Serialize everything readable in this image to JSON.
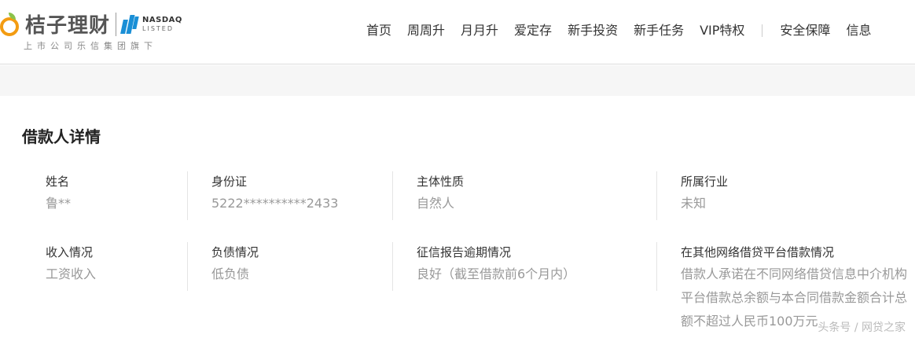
{
  "header": {
    "brand_name": "桔子理财",
    "nasdaq_line1": "NASDAQ",
    "nasdaq_line2": "LISTED",
    "tagline": "上市公司乐信集团旗下",
    "nav": [
      "首页",
      "周周升",
      "月月升",
      "爱定存",
      "新手投资",
      "新手任务",
      "VIP特权",
      "安全保障",
      "信息"
    ]
  },
  "section": {
    "title": "借款人详情"
  },
  "details": {
    "row1": [
      {
        "label": "姓名",
        "value": "鲁**"
      },
      {
        "label": "身份证",
        "value": "5222**********2433"
      },
      {
        "label": "主体性质",
        "value": "自然人"
      },
      {
        "label": "所属行业",
        "value": "未知"
      }
    ],
    "row2": [
      {
        "label": "收入情况",
        "value": "工资收入"
      },
      {
        "label": "负债情况",
        "value": "低负债"
      },
      {
        "label": "征信报告逾期情况",
        "value": "良好（截至借款前6个月内）"
      },
      {
        "label": "在其他网络借贷平台借款情况",
        "value": "借款人承诺在不同网络借贷信息中介机构平台借款总余额与本合同借款金额合计总额不超过人民币100万元"
      }
    ]
  },
  "watermark": "头条号 / 网贷之家"
}
